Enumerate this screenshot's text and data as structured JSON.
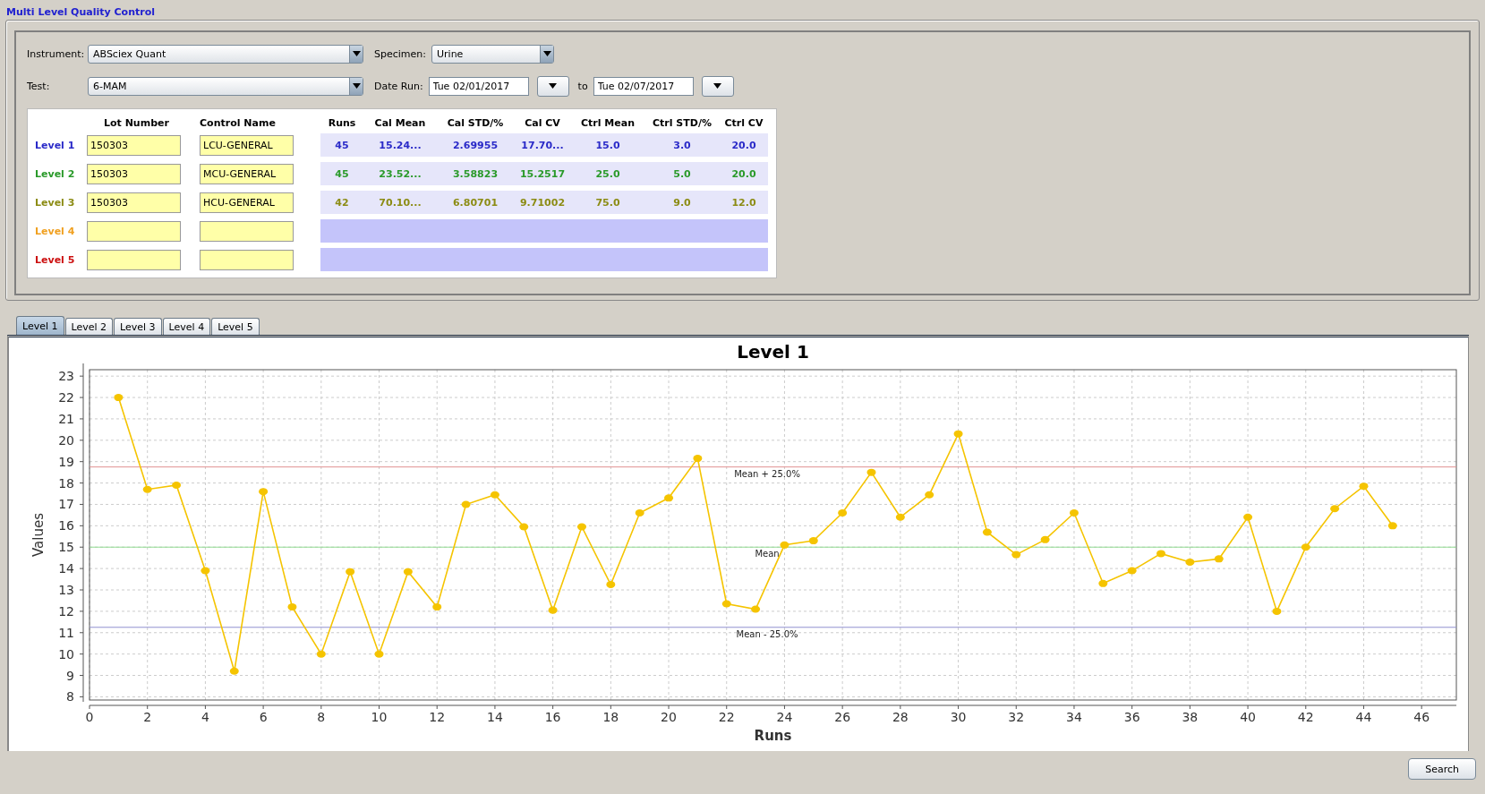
{
  "window": {
    "title": "Multi Level Quality Control"
  },
  "filters": {
    "instrument": {
      "label": "Instrument:",
      "value": "ABSciex Quant"
    },
    "specimen": {
      "label": "Specimen:",
      "value": "Urine"
    },
    "test": {
      "label": "Test:",
      "value": "6-MAM"
    },
    "date_run": {
      "label": "Date Run:",
      "from": "Tue 02/01/2017",
      "separator": "to",
      "to": "Tue 02/07/2017"
    }
  },
  "levels_table": {
    "columns": [
      "Lot Number",
      "Control Name",
      "Runs",
      "Cal Mean",
      "Cal STD/%",
      "Cal CV",
      "Ctrl Mean",
      "Ctrl STD/%",
      "Ctrl CV"
    ],
    "rows": [
      {
        "label": "Level 1",
        "color": "#2a2ac8",
        "lot_number": "150303",
        "control_name": "LCU-GENERAL",
        "values": [
          "45",
          "15.24...",
          "2.69955",
          "17.70...",
          "15.0",
          "3.0",
          "20.0"
        ]
      },
      {
        "label": "Level 2",
        "color": "#2a9a2a",
        "lot_number": "150303",
        "control_name": "MCU-GENERAL",
        "values": [
          "45",
          "23.52...",
          "3.58823",
          "15.2517",
          "25.0",
          "5.0",
          "20.0"
        ]
      },
      {
        "label": "Level 3",
        "color": "#8c8c14",
        "lot_number": "150303",
        "control_name": "HCU-GENERAL",
        "values": [
          "42",
          "70.10...",
          "6.80701",
          "9.71002",
          "75.0",
          "9.0",
          "12.0"
        ]
      },
      {
        "label": "Level 4",
        "color": "#f0a020"
      },
      {
        "label": "Level 5",
        "color": "#cc1010"
      }
    ]
  },
  "tabs": [
    {
      "label": "Level 1",
      "selected": true
    },
    {
      "label": "Level 2",
      "selected": false
    },
    {
      "label": "Level 3",
      "selected": false
    },
    {
      "label": "Level 4",
      "selected": false
    },
    {
      "label": "Level 5",
      "selected": false
    }
  ],
  "chart": {
    "chart_data": {
      "type": "line",
      "title": "Level 1",
      "xlabel": "Runs",
      "ylabel": "Values",
      "x": [
        1,
        2,
        3,
        4,
        5,
        6,
        7,
        8,
        9,
        10,
        11,
        12,
        13,
        14,
        15,
        16,
        17,
        18,
        19,
        20,
        21,
        22,
        23,
        24,
        25,
        26,
        27,
        28,
        29,
        30,
        31,
        32,
        33,
        34,
        35,
        36,
        37,
        38,
        39,
        40,
        41,
        42,
        43,
        44,
        45
      ],
      "series": [
        {
          "color": "#f5c400",
          "marker": "circle",
          "values": [
            22,
            17.7,
            17.9,
            13.9,
            9.2,
            17.6,
            12.2,
            10.0,
            13.85,
            10.0,
            13.85,
            12.2,
            17.0,
            17.45,
            15.95,
            12.05,
            15.95,
            13.25,
            16.6,
            17.3,
            19.15,
            12.35,
            12.1,
            15.1,
            15.3,
            16.6,
            18.5,
            16.4,
            17.45,
            20.3,
            15.7,
            14.65,
            15.35,
            16.6,
            13.3,
            13.9,
            14.7,
            14.3,
            14.45,
            16.4,
            12.0,
            15.0,
            16.8,
            17.85,
            16.0
          ]
        }
      ],
      "xlim": [
        0,
        47.2
      ],
      "ylim": [
        7.85,
        23.3
      ],
      "xticks": [
        0,
        2,
        4,
        6,
        8,
        10,
        12,
        14,
        16,
        18,
        20,
        22,
        24,
        26,
        28,
        30,
        32,
        34,
        36,
        38,
        40,
        42,
        44,
        46
      ],
      "yticks": [
        8,
        9,
        10,
        11,
        12,
        13,
        14,
        15,
        16,
        17,
        18,
        19,
        20,
        21,
        22,
        23
      ],
      "grid": true,
      "ref_lines": [
        {
          "axis": "y",
          "value": 18.75,
          "label": "Mean + 25.0%",
          "color": "#e09090"
        },
        {
          "axis": "y",
          "value": 15,
          "label": "Mean",
          "color": "#90dc90"
        },
        {
          "axis": "y",
          "value": 11.25,
          "label": "Mean - 25.0%",
          "color": "#9090d0"
        }
      ]
    }
  },
  "buttons": [
    {
      "label": "Search"
    }
  ]
}
